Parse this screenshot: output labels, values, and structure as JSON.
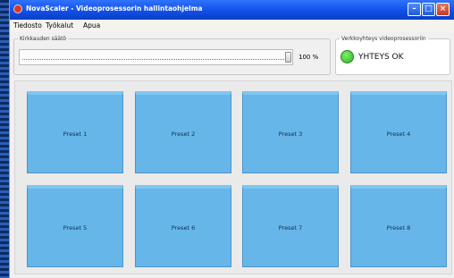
{
  "window": {
    "title": "NovaScaler - Videoprosessorin hallintaohjelma",
    "minimize_icon": "minimize-icon",
    "maximize_icon": "maximize-icon",
    "close_icon": "close-icon",
    "min_glyph": "–",
    "max_glyph": "□",
    "close_glyph": "×"
  },
  "menu": {
    "items": [
      {
        "label": "Tiedosto"
      },
      {
        "label": "Työkalut"
      },
      {
        "label": "Apua"
      }
    ]
  },
  "brightness": {
    "label": "Kirkkauden säätö",
    "value_text": "100 %",
    "level_fraction": 1.0
  },
  "network": {
    "label": "Verkkoyhteys videoprosessoriin",
    "status_text": "YHTEYS OK",
    "status_color": "#3ac12f"
  },
  "presets": {
    "buttons": [
      {
        "label": "Preset 1"
      },
      {
        "label": "Preset 2"
      },
      {
        "label": "Preset 3"
      },
      {
        "label": "Preset 4"
      },
      {
        "label": "Preset 5"
      },
      {
        "label": "Preset 6"
      },
      {
        "label": "Preset 7"
      },
      {
        "label": "Preset 8"
      }
    ]
  },
  "colors": {
    "titlebar": "#1150e7",
    "preset_fill": "#66b6e9"
  }
}
